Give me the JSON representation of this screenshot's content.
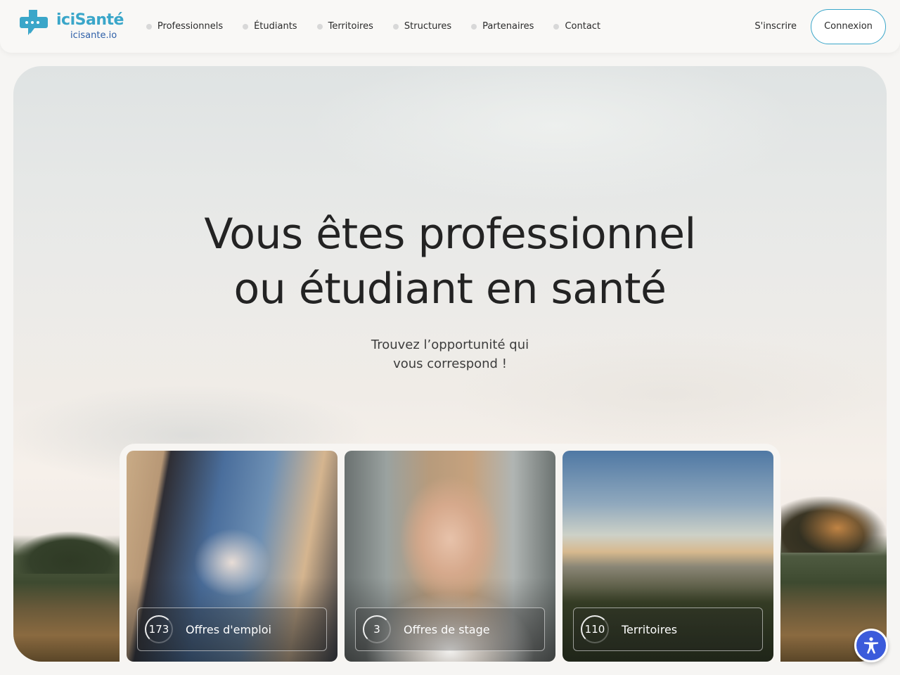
{
  "brand": {
    "name": "iciSanté",
    "url": "icisante.io",
    "primary_color": "#3aa6c9",
    "secondary_color": "#2e5fa8"
  },
  "nav": {
    "items": [
      {
        "label": "Professionnels"
      },
      {
        "label": "Étudiants"
      },
      {
        "label": "Territoires"
      },
      {
        "label": "Structures"
      },
      {
        "label": "Partenaires"
      },
      {
        "label": "Contact"
      }
    ],
    "signup_label": "S'inscrire",
    "login_label": "Connexion"
  },
  "hero": {
    "title_line1": "Vous êtes professionnel",
    "title_line2": "ou étudiant en santé",
    "subtitle_line1": "Trouvez l’opportunité qui",
    "subtitle_line2": "vous correspond !"
  },
  "cards": [
    {
      "count": "173",
      "label": "Offres d'emploi"
    },
    {
      "count": "3",
      "label": "Offres de stage"
    },
    {
      "count": "110",
      "label": "Territoires"
    }
  ],
  "accessibility": {
    "icon": "accessibility-icon",
    "color": "#3b5bdb"
  }
}
